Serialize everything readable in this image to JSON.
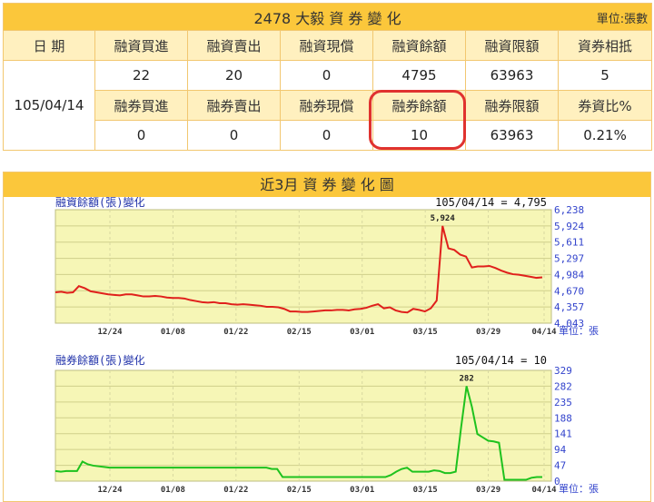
{
  "table": {
    "title": "2478 大毅 資 券 變 化",
    "unit": "單位:張數",
    "date_header": "日 期",
    "date": "105/04/14",
    "margin_headers": [
      "融資買進",
      "融資賣出",
      "融資現償",
      "融資餘額",
      "融資限額",
      "資券相抵"
    ],
    "margin_values": [
      "22",
      "20",
      "0",
      "4795",
      "63963",
      "5"
    ],
    "short_headers": [
      "融券買進",
      "融券賣出",
      "融券現償",
      "融券餘額",
      "融券限額",
      "券資比%"
    ],
    "short_values": [
      "0",
      "0",
      "0",
      "10",
      "63963",
      "0.21%"
    ]
  },
  "chart_section_title": "近3月 資 券 變 化 圖",
  "colors": {
    "accent": "#fbc73b",
    "header_bg": "#fff0bf",
    "margin_line": "#e0201c",
    "short_line": "#1ec21e",
    "highlight": "#e0322f"
  },
  "chart_data": [
    {
      "type": "line",
      "title": "融資餘額(張)變化",
      "annotation": "105/04/14 = 4,795",
      "peak_label": "5,924",
      "unit_label": "單位：張",
      "x_ticks": [
        "12/24",
        "01/08",
        "01/22",
        "02/15",
        "03/01",
        "03/15",
        "03/29",
        "04/14"
      ],
      "y_ticks": [
        "6,238",
        "5,924",
        "5,611",
        "5,297",
        "4,984",
        "4,670",
        "4,357",
        "4,043"
      ],
      "ylim": [
        4043,
        6238
      ],
      "series": [
        {
          "values": [
            4640,
            4650,
            4630,
            4640,
            4760,
            4720,
            4660,
            4640,
            4620,
            4600,
            4590,
            4580,
            4600,
            4600,
            4580,
            4560,
            4560,
            4570,
            4560,
            4540,
            4530,
            4530,
            4520,
            4490,
            4470,
            4450,
            4440,
            4450,
            4430,
            4430,
            4410,
            4400,
            4410,
            4400,
            4390,
            4380,
            4360,
            4360,
            4350,
            4320,
            4270,
            4270,
            4260,
            4260,
            4270,
            4280,
            4290,
            4290,
            4300,
            4300,
            4290,
            4310,
            4320,
            4340,
            4380,
            4410,
            4330,
            4350,
            4290,
            4260,
            4250,
            4320,
            4300,
            4270,
            4330,
            4480,
            5924,
            5490,
            5460,
            5370,
            5330,
            5120,
            5140,
            5140,
            5150,
            5110,
            5060,
            5020,
            4990,
            4980,
            4960,
            4940,
            4920,
            4930
          ]
        }
      ]
    },
    {
      "type": "line",
      "title": "融券餘額(張)變化",
      "annotation": "105/04/14 = 10",
      "peak_label": "282",
      "unit_label": "單位：張",
      "x_ticks": [
        "12/24",
        "01/08",
        "01/22",
        "02/15",
        "03/01",
        "03/15",
        "03/29",
        "04/14"
      ],
      "y_ticks": [
        "329",
        "282",
        "235",
        "188",
        "141",
        "94",
        "47",
        "0"
      ],
      "ylim": [
        0,
        329
      ],
      "series": [
        {
          "values": [
            30,
            28,
            30,
            30,
            30,
            58,
            50,
            46,
            44,
            42,
            40,
            40,
            40,
            40,
            40,
            40,
            40,
            40,
            40,
            40,
            40,
            40,
            40,
            40,
            40,
            40,
            40,
            40,
            40,
            40,
            40,
            40,
            40,
            40,
            40,
            40,
            40,
            40,
            40,
            40,
            36,
            36,
            12,
            12,
            12,
            12,
            12,
            12,
            12,
            12,
            12,
            12,
            12,
            12,
            12,
            12,
            12,
            12,
            12,
            12,
            12,
            12,
            18,
            28,
            36,
            40,
            28,
            28,
            28,
            28,
            32,
            30,
            24,
            24,
            28,
            160,
            282,
            220,
            140,
            130,
            120,
            118,
            114,
            4,
            4,
            4,
            4,
            4,
            10,
            12,
            12
          ]
        }
      ]
    }
  ]
}
